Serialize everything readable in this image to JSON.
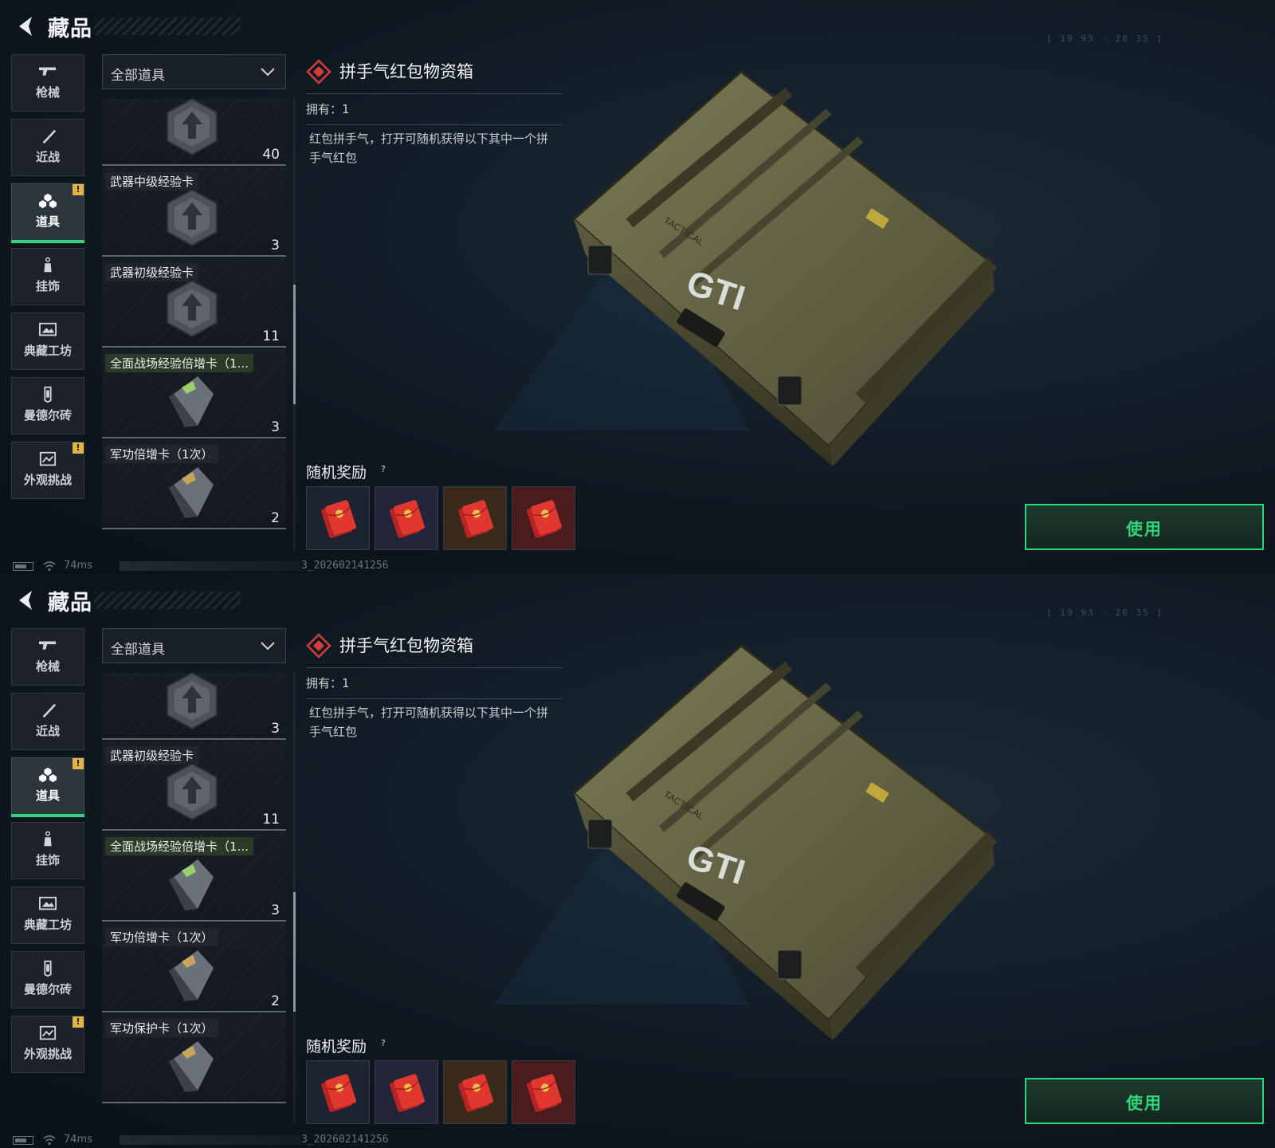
{
  "colors": {
    "accent_green": "#2fd57b",
    "badge_yellow": "#e2b443",
    "rarity_red": "#d63b3b"
  },
  "screens": [
    {
      "header": {
        "title": "藏品",
        "back_icon": "chevron-left-icon",
        "coord_text": "[ 19 93 · 20 35 ]"
      },
      "nav": [
        {
          "label": "枪械",
          "icon": "gun-icon",
          "active": false,
          "badge": ""
        },
        {
          "label": "近战",
          "icon": "knife-icon",
          "active": false,
          "badge": ""
        },
        {
          "label": "道具",
          "icon": "items-cluster-icon",
          "active": true,
          "badge": "!"
        },
        {
          "label": "挂饰",
          "icon": "charm-icon",
          "active": false,
          "badge": ""
        },
        {
          "label": "典藏工坊",
          "icon": "workshop-frame-icon",
          "active": false,
          "badge": ""
        },
        {
          "label": "曼德尔砖",
          "icon": "mandel-brick-icon",
          "active": false,
          "badge": ""
        },
        {
          "label": "外观挑战",
          "icon": "appearance-challenge-icon",
          "active": false,
          "badge": "!"
        }
      ],
      "filter": {
        "label": "全部道具",
        "icon": "chevron-down-icon"
      },
      "list_items": [
        {
          "name": "",
          "count": "40",
          "icon": "weapon-exp-card-icon",
          "partial_top": true
        },
        {
          "name": "武器中级经验卡",
          "count": "3",
          "icon": "weapon-exp-card-icon"
        },
        {
          "name": "武器初级经验卡",
          "count": "11",
          "icon": "weapon-exp-card-icon"
        },
        {
          "name": "全面战场经验倍增卡（1...",
          "count": "3",
          "icon": "exp-boost-card-icon",
          "green": true
        },
        {
          "name": "军功倍增卡（1次）",
          "count": "2",
          "icon": "merit-boost-card-icon"
        }
      ],
      "scroll_fraction": 0.56,
      "detail": {
        "icon": "red-diamond-icon",
        "title": "拼手气红包物资箱",
        "owned": "拥有：1",
        "description": "红包拼手气，打开可随机获得以下其中一个拼手气红包"
      },
      "rewards": {
        "title": "随机奖励",
        "help": "?",
        "items": [
          {
            "icon": "red-envelope-icon",
            "bg": "#1e2331"
          },
          {
            "icon": "red-envelope-icon",
            "bg": "#23263a"
          },
          {
            "icon": "red-envelope-icon",
            "bg": "#3a2a1c"
          },
          {
            "icon": "red-envelope-icon",
            "bg": "#4a1c1e"
          }
        ]
      },
      "preview": {
        "icon": "military-crate-icon",
        "crate_label": "GTI",
        "crate_sub": "TACTICAL"
      },
      "use_button": "使用",
      "status": {
        "ping": "74ms",
        "build": "3_202602141256"
      }
    },
    {
      "header": {
        "title": "藏品",
        "back_icon": "chevron-left-icon",
        "coord_text": "[ 19 93 · 20 35 ]"
      },
      "nav": [
        {
          "label": "枪械",
          "icon": "gun-icon",
          "active": false,
          "badge": ""
        },
        {
          "label": "近战",
          "icon": "knife-icon",
          "active": false,
          "badge": ""
        },
        {
          "label": "道具",
          "icon": "items-cluster-icon",
          "active": true,
          "badge": "!"
        },
        {
          "label": "挂饰",
          "icon": "charm-icon",
          "active": false,
          "badge": ""
        },
        {
          "label": "典藏工坊",
          "icon": "workshop-frame-icon",
          "active": false,
          "badge": ""
        },
        {
          "label": "曼德尔砖",
          "icon": "mandel-brick-icon",
          "active": false,
          "badge": ""
        },
        {
          "label": "外观挑战",
          "icon": "appearance-challenge-icon",
          "active": false,
          "badge": "!"
        }
      ],
      "filter": {
        "label": "全部道具",
        "icon": "chevron-down-icon"
      },
      "list_items": [
        {
          "name": "",
          "count": "3",
          "icon": "weapon-exp-card-icon",
          "partial_top": true
        },
        {
          "name": "武器初级经验卡",
          "count": "11",
          "icon": "weapon-exp-card-icon"
        },
        {
          "name": "全面战场经验倍增卡（1...",
          "count": "3",
          "icon": "exp-boost-card-icon",
          "green": true
        },
        {
          "name": "军功倍增卡（1次）",
          "count": "2",
          "icon": "merit-boost-card-icon"
        },
        {
          "name": "军功保护卡（1次）",
          "count": "",
          "icon": "merit-protect-card-icon"
        }
      ],
      "scroll_fraction": 0.66,
      "detail": {
        "icon": "red-diamond-icon",
        "title": "拼手气红包物资箱",
        "owned": "拥有：1",
        "description": "红包拼手气，打开可随机获得以下其中一个拼手气红包"
      },
      "rewards": {
        "title": "随机奖励",
        "help": "?",
        "items": [
          {
            "icon": "red-envelope-icon",
            "bg": "#1e2331"
          },
          {
            "icon": "red-envelope-icon",
            "bg": "#23263a"
          },
          {
            "icon": "red-envelope-icon",
            "bg": "#3a2a1c"
          },
          {
            "icon": "red-envelope-icon",
            "bg": "#4a1c1e"
          }
        ]
      },
      "preview": {
        "icon": "military-crate-icon",
        "crate_label": "GTI",
        "crate_sub": "TACTICAL"
      },
      "use_button": "使用",
      "status": {
        "ping": "74ms",
        "build": "3_202602141256"
      }
    }
  ]
}
